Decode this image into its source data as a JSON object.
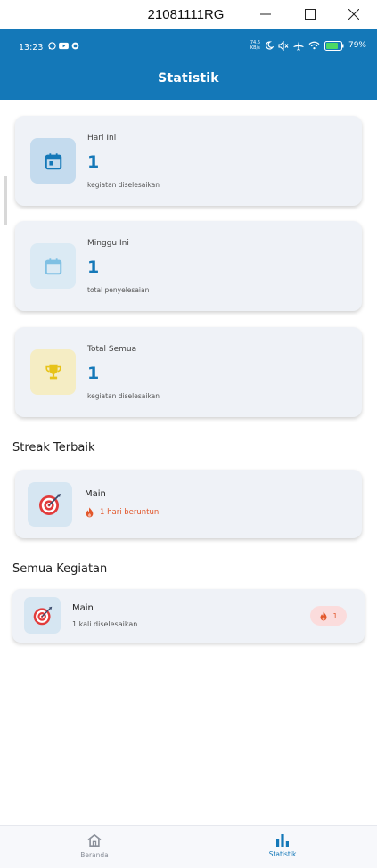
{
  "window": {
    "title": "21081111RG"
  },
  "status_bar": {
    "time": "13:23",
    "net_speed_top": "74.6",
    "net_speed_bottom": "KB/s",
    "battery": "79%"
  },
  "app_bar": {
    "title": "Statistik"
  },
  "stats": [
    {
      "label": "Hari Ini",
      "value": "1",
      "sub": "kegiatan diselesaikan",
      "icon": "calendar-today-icon",
      "color": "#1478b8"
    },
    {
      "label": "Minggu Ini",
      "value": "1",
      "sub": "total penyelesaian",
      "icon": "calendar-week-icon",
      "color": "#7fc0e3"
    },
    {
      "label": "Total Semua",
      "value": "1",
      "sub": "kegiatan diselesaikan",
      "icon": "trophy-icon",
      "color": "#e7c319"
    }
  ],
  "streak": {
    "title": "Streak Terbaik",
    "name": "Main",
    "text": "1 hari beruntun",
    "icon": "target-icon"
  },
  "activities": {
    "title": "Semua Kegiatan",
    "items": [
      {
        "name": "Main",
        "sub": "1 kali diselesaikan",
        "badge": "1",
        "icon": "target-icon"
      }
    ]
  },
  "bottom_nav": [
    {
      "label": "Beranda",
      "icon": "home-icon",
      "active": false
    },
    {
      "label": "Statistik",
      "icon": "bar-chart-icon",
      "active": true
    }
  ],
  "colors": {
    "primary": "#1478b8",
    "card": "#eff2f7",
    "streak": "#e2582c"
  }
}
